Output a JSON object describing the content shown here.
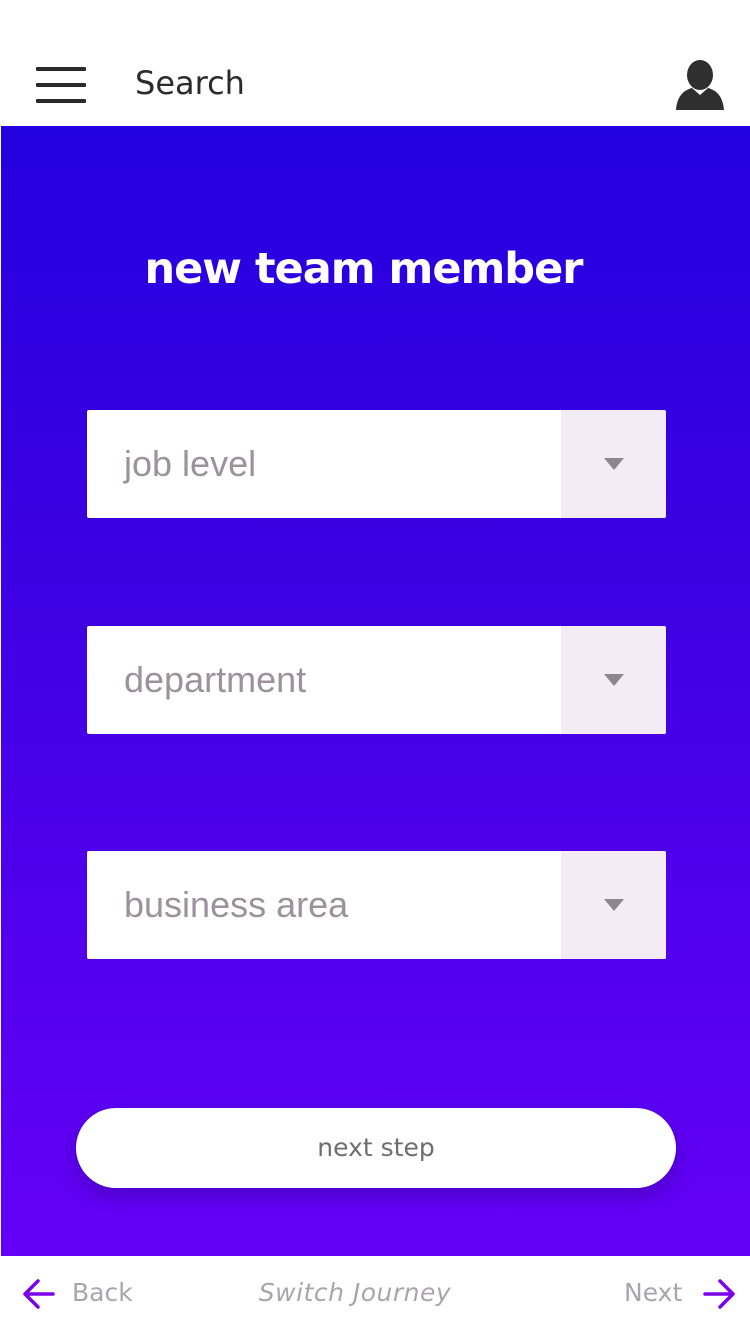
{
  "header": {
    "menu_icon": "hamburger-menu-icon",
    "search_label": "Search",
    "avatar_icon": "user-avatar-icon"
  },
  "main": {
    "title": "new team member",
    "selects": [
      {
        "label": "job level",
        "icon": "caret-down-icon"
      },
      {
        "label": "department",
        "icon": "caret-down-icon"
      },
      {
        "label": "business area",
        "icon": "caret-down-icon"
      }
    ],
    "next_step_label": "next step",
    "background_colors": [
      "#2300df",
      "#6400f6"
    ]
  },
  "footer": {
    "back_label": "Back",
    "switch_label": "Switch Journey",
    "next_label": "Next",
    "arrow_color": "#7a00ee"
  }
}
